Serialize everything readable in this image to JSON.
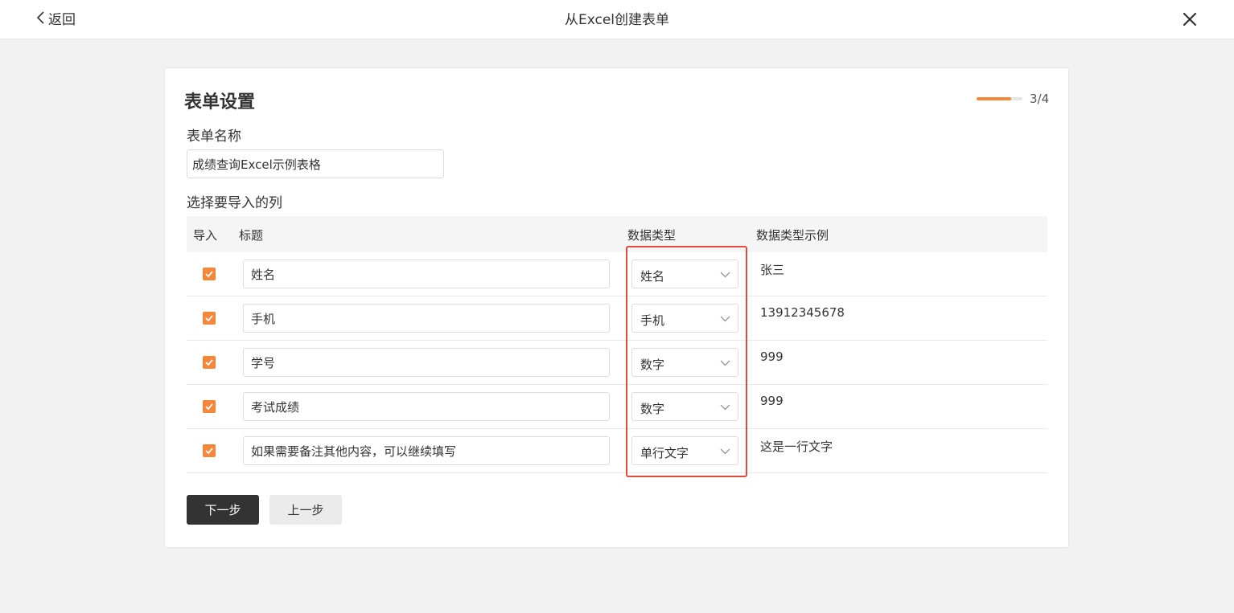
{
  "header": {
    "back_label": "返回",
    "title": "从Excel创建表单"
  },
  "form": {
    "heading": "表单设置",
    "step": {
      "current": 3,
      "total": 4,
      "label": "3/4",
      "fraction": 0.75
    },
    "name_label": "表单名称",
    "name_value": "成绩查询Excel示例表格",
    "columns_label": "选择要导入的列"
  },
  "table": {
    "headers": {
      "import": "导入",
      "title": "标题",
      "type": "数据类型",
      "example": "数据类型示例"
    },
    "rows": [
      {
        "checked": true,
        "title": "姓名",
        "type": "姓名",
        "example": "张三"
      },
      {
        "checked": true,
        "title": "手机",
        "type": "手机",
        "example": "13912345678"
      },
      {
        "checked": true,
        "title": "学号",
        "type": "数字",
        "example": "999"
      },
      {
        "checked": true,
        "title": "考试成绩",
        "type": "数字",
        "example": "999"
      },
      {
        "checked": true,
        "title": "如果需要备注其他内容，可以继续填写",
        "type": "单行文字",
        "example": "这是一行文字"
      }
    ]
  },
  "actions": {
    "next_label": "下一步",
    "prev_label": "上一步"
  },
  "colors": {
    "accent": "#f5873a",
    "highlight_border": "#e24c3f",
    "primary_button": "#333333"
  },
  "icons": {
    "back": "chevron-left-icon",
    "close": "close-icon",
    "checkbox": "check-icon",
    "select": "chevron-down-icon"
  }
}
